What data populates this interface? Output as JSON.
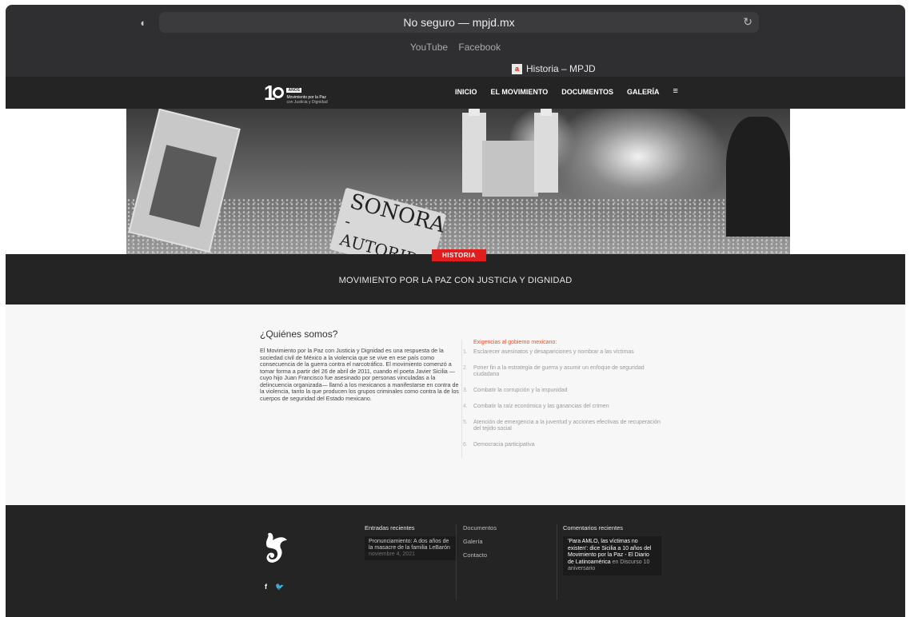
{
  "browser": {
    "url": "No seguro — mpjd.mx",
    "bookmarks": [
      "YouTube",
      "Facebook"
    ],
    "tab_title": "Historia – MPJD"
  },
  "header": {
    "logo_number": "10",
    "logo_anos": "AÑOS",
    "logo_line1": "Movimiento por la Paz",
    "logo_line2": "con Justicia y Dignidad",
    "nav": [
      "INICIO",
      "EL MOVIMIENTO",
      "DOCUMENTOS",
      "GALERÍA"
    ],
    "menu_glyph": "≡"
  },
  "hero": {
    "sign_line1": "SONORA",
    "sign_line2": "-AUTORIDAD"
  },
  "title_band": {
    "category": "HISTORIA",
    "title": "MOVIMIENTO POR LA PAZ CON JUSTICIA Y DIGNIDAD"
  },
  "about": {
    "heading": "¿Quiénes somos?",
    "text": "El Movimiento por la Paz con Justicia y Dignidad es una respuesta de la sociedad civil de México a la violencia que se vive en ese país como consecuencia de la guerra contra el narcotráfico. El movimiento comenzó a tomar forma a partir del 26 de abril de 2011, cuando el poeta Javier Sicilia —cuyo hijo Juan Francisco fue asesinado por personas vinculadas a la delincuencia organizada— llamó a los mexicanos a manifestarse en contra de la violencia, tanto la que producen los grupos criminales como contra la de los cuerpos de seguridad del Estado mexicano."
  },
  "demands": {
    "title": "Exigencias al gobierno mexicano:",
    "items": [
      {
        "num": "1.",
        "text": "Esclarecer asesinatos y desapariciones y nombrar a las víctimas"
      },
      {
        "num": "2.",
        "text": "Poner fin a la estrategia de guerra y asumir un enfoque de seguridad ciudadana"
      },
      {
        "num": "3.",
        "text": "Combatir la corrupción y la impunidad"
      },
      {
        "num": "4.",
        "text": "Combatir la raíz económica y las ganancias del crimen"
      },
      {
        "num": "5.",
        "text": "Atención de emergencia a la juventud y acciones efectivas de recuperación del tejido social"
      },
      {
        "num": "6.",
        "text": "Democracia participativa"
      }
    ]
  },
  "footer": {
    "social": [
      "f",
      "🐦"
    ],
    "recent_title": "Entradas recientes",
    "recent_post": "Pronunciamiento: A dos años de la masacre de la familia LeBarón",
    "recent_date": "noviembre 4, 2021",
    "links": [
      "Documentos",
      "Galería",
      "Contacto"
    ],
    "comments_title": "Comentarios recientes",
    "comment_link": "'Para AMLO, las víctimas no existen': dice Sicilia a 10 años del Movimiento por la Paz - El Diario de Latinoamérica",
    "comment_en": " en ",
    "comment_post": "Discurso 10 aniversario"
  },
  "colors": {
    "accent": "#e01e1e",
    "dark": "#242424",
    "demands_title": "#e0522a"
  }
}
